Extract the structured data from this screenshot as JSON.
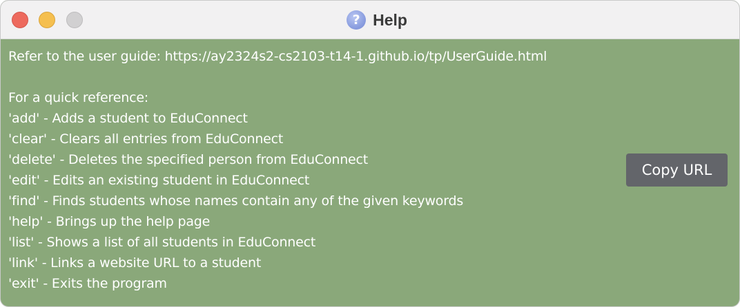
{
  "window": {
    "title": "Help",
    "title_icon": "question-mark-icon",
    "background_color": "#8aa87a"
  },
  "content": {
    "guide_line": "Refer to the user guide: https://ay2324s2-cs2103-t14-1.github.io/tp/UserGuide.html",
    "quick_reference_heading": "For a quick reference:",
    "commands": [
      "'add' - Adds a student to EduConnect",
      "'clear' - Clears all entries from EduConnect",
      "'delete' - Deletes the specified person from EduConnect",
      "'edit' - Edits an existing student in EduConnect",
      "'find' - Finds students whose names contain any of the given keywords",
      "'help' - Brings up the help page",
      "'list' - Shows a list of all students in EduConnect",
      "'link' - Links a website URL to a student",
      "'exit' - Exits the program"
    ]
  },
  "buttons": {
    "copy_url_label": "Copy URL"
  }
}
